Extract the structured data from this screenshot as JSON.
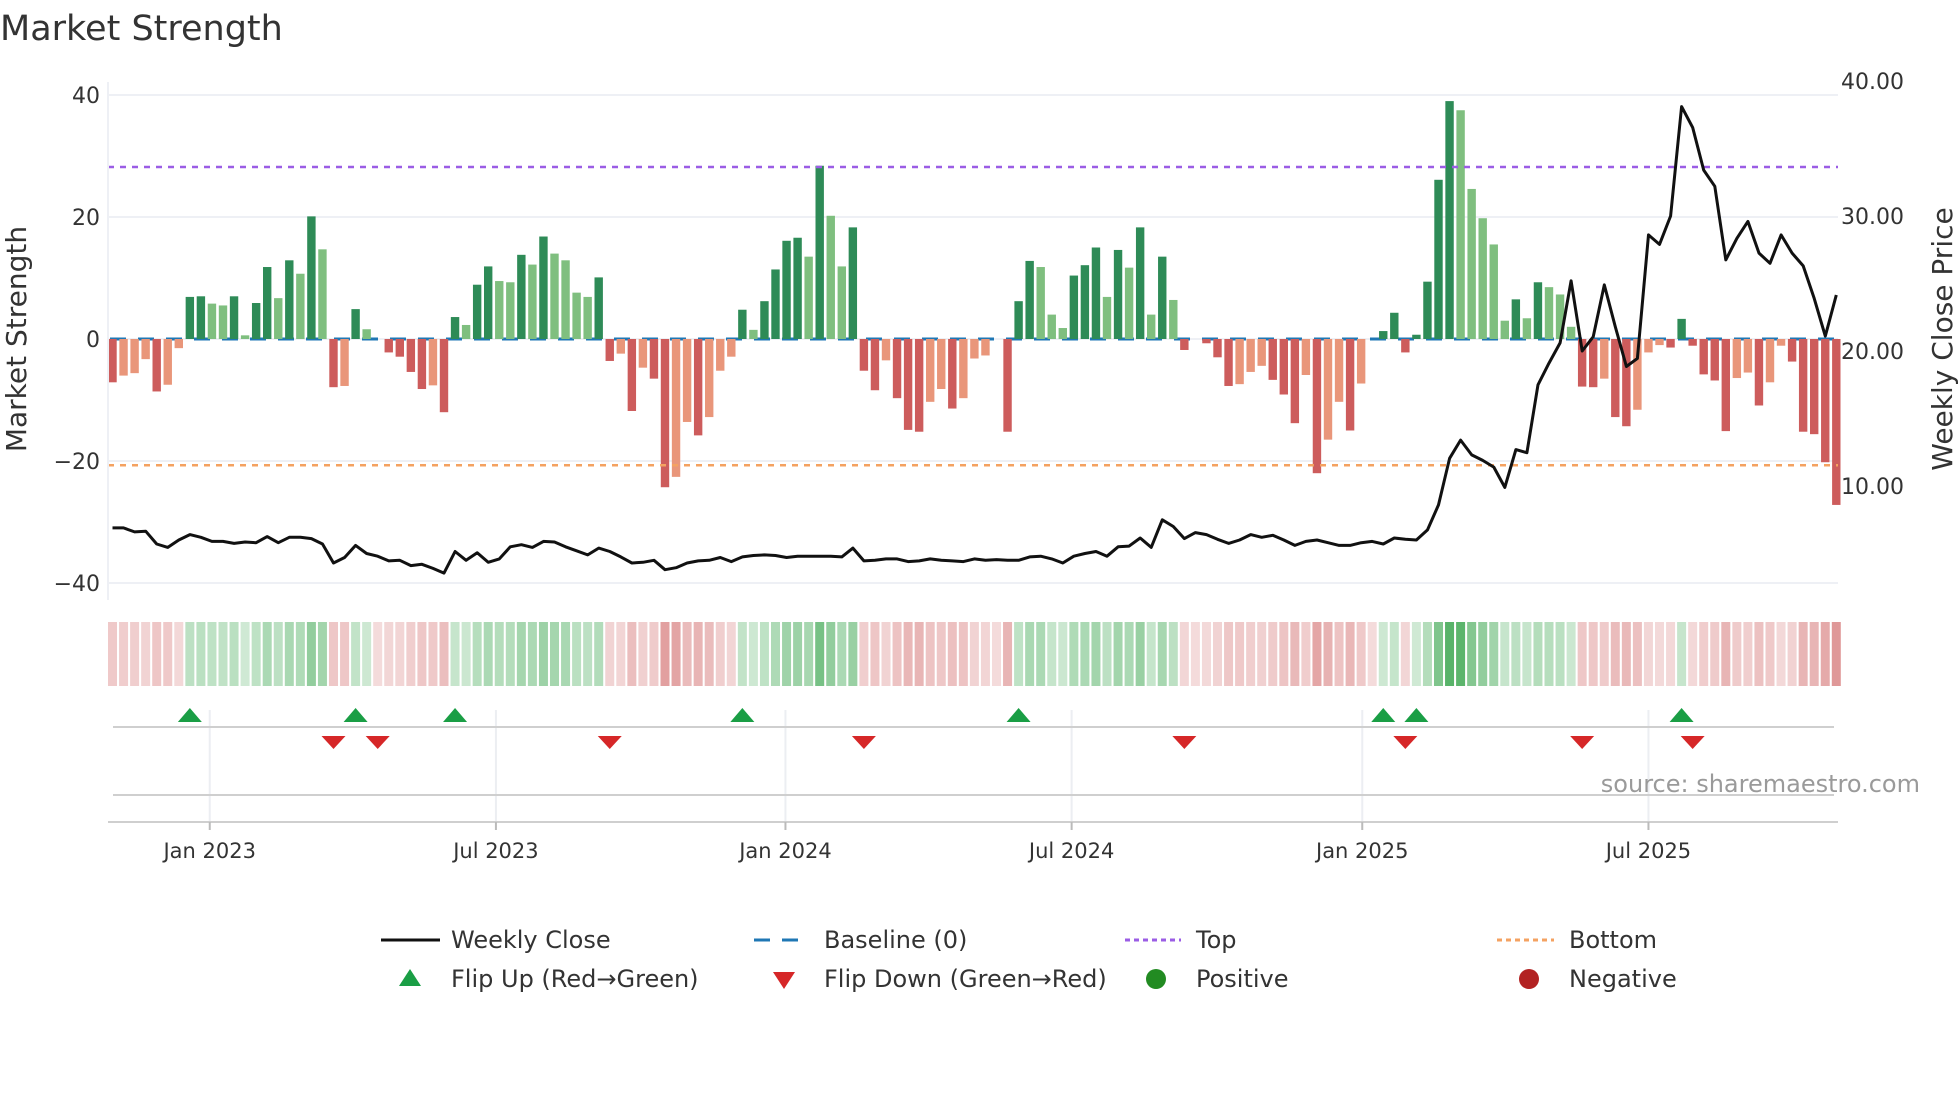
{
  "chart_data": {
    "type": "bar",
    "title": "Market Strength",
    "ylabel": "Market Strength",
    "y2label": "Weekly Close Price",
    "ylim": [
      -40,
      40
    ],
    "y2lim": [
      1,
      41
    ],
    "yticks": [
      "40",
      "20",
      "0",
      "−20",
      "−40"
    ],
    "ytick_values": [
      40,
      20,
      0,
      -20,
      -40
    ],
    "y2ticks": [
      "40.00",
      "30.00",
      "20.00",
      "10.00"
    ],
    "y2tick_values": [
      40,
      30,
      20,
      10
    ],
    "top_level": 28.2,
    "bottom_level": -20.7,
    "grid": true,
    "x_ticks": [
      {
        "label": "Jan 2023",
        "week_index": 8.8
      },
      {
        "label": "Jul 2023",
        "week_index": 34.7
      },
      {
        "label": "Jan 2024",
        "week_index": 60.9
      },
      {
        "label": "Jul 2024",
        "week_index": 86.8
      },
      {
        "label": "Jan 2025",
        "week_index": 113.1
      },
      {
        "label": "Jul 2025",
        "week_index": 139.0
      }
    ],
    "strength": [
      -7.1,
      -6,
      -5.6,
      -3.3,
      -8.6,
      -7.5,
      -1.5,
      6.9,
      7,
      5.8,
      5.5,
      7,
      0.6,
      5.9,
      11.8,
      6.7,
      12.9,
      10.7,
      20.1,
      14.7,
      -7.9,
      -7.7,
      4.9,
      1.6,
      0,
      -2.2,
      -2.9,
      -5.4,
      -8.2,
      -7.6,
      -12,
      3.6,
      2.3,
      8.9,
      11.9,
      9.5,
      9.3,
      13.8,
      12.2,
      16.8,
      14,
      12.9,
      7.6,
      6.9,
      10.1,
      -3.6,
      -2.4,
      -11.8,
      -4.7,
      -6.5,
      -24.3,
      -22.6,
      -13.6,
      -15.8,
      -12.8,
      -5.2,
      -2.9,
      4.8,
      1.5,
      6.2,
      11.4,
      16.1,
      16.6,
      13.5,
      28.4,
      20.2,
      11.9,
      18.3,
      -5.2,
      -8.4,
      -3.5,
      -9.7,
      -14.9,
      -15.2,
      -10.3,
      -8.2,
      -11.4,
      -9.7,
      -3.2,
      -2.7,
      0,
      -15.2,
      6.2,
      12.8,
      11.8,
      4,
      1.8,
      10.4,
      12.1,
      15,
      6.9,
      14.6,
      11.7,
      18.3,
      4,
      13.5,
      6.4,
      -1.8,
      0,
      -0.7,
      -3,
      -7.7,
      -7.4,
      -5.4,
      -4.4,
      -6.7,
      -9.1,
      -13.8,
      -5.9,
      -22,
      -16.5,
      -10.3,
      -15,
      -7.3,
      0,
      1.3,
      4.3,
      -2.2,
      0.7,
      9.4,
      26.1,
      39,
      37.5,
      24.6,
      19.8,
      15.5,
      3,
      6.5,
      3.4,
      9.3,
      8.5,
      7.3,
      2,
      -7.8,
      -7.9,
      -6.5,
      -12.8,
      -14.3,
      -11.6,
      -2.2,
      -1,
      -1.4,
      3.3,
      -1.1,
      -5.8,
      -6.8,
      -15.1,
      -6.4,
      -5.5,
      -10.9,
      -7.1,
      -1.1,
      -3.7,
      -15.2,
      -15.6,
      -20.2,
      -27.2
    ],
    "weekly_close": [
      6.9,
      6.9,
      6.6,
      6.65,
      5.7,
      5.45,
      6.0,
      6.4,
      6.2,
      5.9,
      5.9,
      5.75,
      5.85,
      5.8,
      6.25,
      5.8,
      6.2,
      6.2,
      6.1,
      5.7,
      4.3,
      4.7,
      5.6,
      5.0,
      4.8,
      4.45,
      4.5,
      4.1,
      4.2,
      3.9,
      3.55,
      5.15,
      4.5,
      5.05,
      4.35,
      4.6,
      5.5,
      5.65,
      5.45,
      5.9,
      5.85,
      5.5,
      5.2,
      4.9,
      5.4,
      5.15,
      4.75,
      4.3,
      4.35,
      4.5,
      3.8,
      3.95,
      4.3,
      4.45,
      4.5,
      4.7,
      4.4,
      4.75,
      4.85,
      4.9,
      4.85,
      4.7,
      4.8,
      4.8,
      4.8,
      4.8,
      4.75,
      5.4,
      4.45,
      4.5,
      4.6,
      4.6,
      4.4,
      4.45,
      4.6,
      4.5,
      4.45,
      4.4,
      4.6,
      4.5,
      4.55,
      4.5,
      4.5,
      4.75,
      4.8,
      4.6,
      4.3,
      4.8,
      5.0,
      5.15,
      4.8,
      5.5,
      5.55,
      6.15,
      5.45,
      7.5,
      7.0,
      6.1,
      6.55,
      6.4,
      6.05,
      5.75,
      6.0,
      6.4,
      6.2,
      6.35,
      6.0,
      5.6,
      5.9,
      6.0,
      5.8,
      5.6,
      5.6,
      5.8,
      5.9,
      5.7,
      6.15,
      6.05,
      6.0,
      6.75,
      8.6,
      12.05,
      13.4,
      12.3,
      11.9,
      11.4,
      9.9,
      12.7,
      12.47,
      17.5,
      19.1,
      20.6,
      25.2,
      20.0,
      21.05,
      24.9,
      21.8,
      18.85,
      19.45,
      28.6,
      27.9,
      30.0,
      38.1,
      36.55,
      33.4,
      32.2,
      26.75,
      28.35,
      29.6,
      27.25,
      26.5,
      28.6,
      27.25,
      26.3,
      23.9,
      21.1,
      24.15
    ],
    "colors": {
      "pos_rising": "#2e8b57",
      "pos_falling": "#7fbf7f",
      "neg_falling": "#cd5c5c",
      "neg_rising": "#e9967a",
      "baseline": "#1f77b4",
      "top": "#9b5de5",
      "bottom": "#f4a261",
      "close": "#111111",
      "flip_up": "#1a9e45",
      "flip_down": "#d62728",
      "positive": "#228b22",
      "negative": "#b22222"
    },
    "legend": {
      "weekly_close": "Weekly Close",
      "baseline": "Baseline (0)",
      "top": "Top",
      "bottom": "Bottom",
      "flip_up": "Flip Up (Red→Green)",
      "flip_down": "Flip Down (Green→Red)",
      "positive": "Positive",
      "negative": "Negative"
    },
    "source": "source: sharemaestro.com"
  }
}
